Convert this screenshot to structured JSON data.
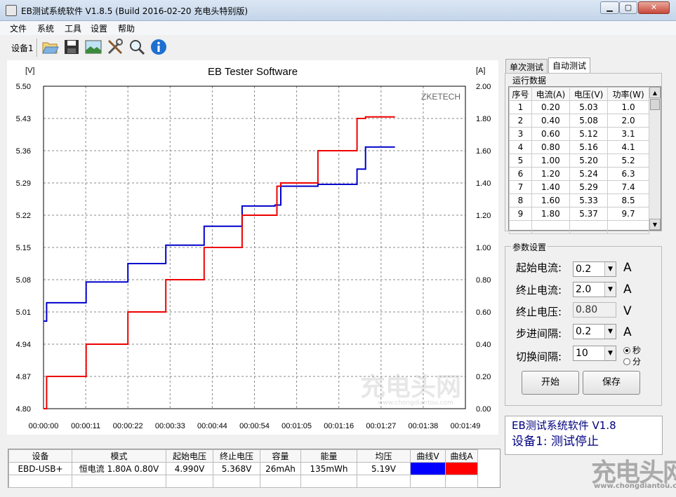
{
  "window": {
    "title": "EB测试系统软件 V1.8.5 (Build 2016-02-20 充电头特别版)"
  },
  "menu": [
    "文件",
    "系统",
    "工具",
    "设置",
    "帮助"
  ],
  "toolbar": {
    "device_label": "设备1",
    "icons": [
      "open-folder-icon",
      "save-icon",
      "image-icon",
      "tools-icon",
      "search-icon",
      "info-icon"
    ]
  },
  "chart_data": {
    "type": "line",
    "title": "EB Tester Software",
    "watermark_text": "ZKETECH",
    "y_left_unit": "[V]",
    "y_right_unit": "[A]",
    "y_left_range": [
      4.8,
      5.5
    ],
    "y_right_range": [
      0.0,
      2.0
    ],
    "x_range_seconds": [
      0,
      109
    ],
    "y_left_ticks": [
      "5.50",
      "5.43",
      "5.36",
      "5.29",
      "5.22",
      "5.15",
      "5.08",
      "5.01",
      "4.94",
      "4.87",
      "4.80"
    ],
    "y_right_ticks": [
      "2.00",
      "1.80",
      "1.60",
      "1.40",
      "1.20",
      "1.00",
      "0.80",
      "0.60",
      "0.40",
      "0.20",
      "0.00"
    ],
    "x_ticks": [
      "00:00:00",
      "00:00:11",
      "00:00:22",
      "00:00:33",
      "00:00:44",
      "00:00:54",
      "00:01:05",
      "00:01:16",
      "00:01:27",
      "00:01:38",
      "00:01:49"
    ],
    "series": [
      {
        "color": "#0000cc",
        "axis": "left",
        "x": [
          0,
          0.8,
          0.8,
          11,
          11,
          21.8,
          21.8,
          31.6,
          31.6,
          41.5,
          41.5,
          51.3,
          51.3,
          59.8,
          59.8,
          61.3,
          61.3,
          70.9,
          70.9,
          81,
          81,
          83.2,
          83.2,
          90.8
        ],
        "y": [
          4.99,
          4.99,
          5.03,
          5.03,
          5.075,
          5.075,
          5.115,
          5.115,
          5.155,
          5.155,
          5.196,
          5.196,
          5.24,
          5.24,
          5.242,
          5.242,
          5.283,
          5.283,
          5.287,
          5.287,
          5.32,
          5.32,
          5.368,
          5.368
        ]
      },
      {
        "color": "#ee0000",
        "axis": "right",
        "x": [
          0,
          0.8,
          0.8,
          11,
          11,
          21.8,
          21.8,
          31.6,
          31.6,
          41.5,
          41.5,
          51.3,
          51.3,
          60.3,
          60.3,
          61.3,
          61.3,
          70.9,
          70.9,
          81,
          81,
          83.2,
          83.2,
          90.8
        ],
        "y": [
          0,
          0,
          0.2,
          0.2,
          0.4,
          0.4,
          0.6,
          0.6,
          0.8,
          0.8,
          1.0,
          1.0,
          1.2,
          1.2,
          1.38,
          1.38,
          1.4,
          1.4,
          1.6,
          1.6,
          1.8,
          1.8,
          1.81,
          1.81
        ]
      }
    ]
  },
  "tabs": [
    "单次测试",
    "自动测试"
  ],
  "run_data": {
    "title": "运行数据",
    "columns": [
      "序号",
      "电流(A)",
      "电压(V)",
      "功率(W)"
    ],
    "rows": [
      [
        "1",
        "0.20",
        "5.03",
        "1.0"
      ],
      [
        "2",
        "0.40",
        "5.08",
        "2.0"
      ],
      [
        "3",
        "0.60",
        "5.12",
        "3.1"
      ],
      [
        "4",
        "0.80",
        "5.16",
        "4.1"
      ],
      [
        "5",
        "1.00",
        "5.20",
        "5.2"
      ],
      [
        "6",
        "1.20",
        "5.24",
        "6.3"
      ],
      [
        "7",
        "1.40",
        "5.29",
        "7.4"
      ],
      [
        "8",
        "1.60",
        "5.33",
        "8.5"
      ],
      [
        "9",
        "1.80",
        "5.37",
        "9.7"
      ]
    ]
  },
  "params": {
    "title": "参数设置",
    "start_current_label": "起始电流:",
    "start_current_value": "0.2",
    "start_current_unit": "A",
    "end_current_label": "终止电流:",
    "end_current_value": "2.0",
    "end_current_unit": "A",
    "end_voltage_label": "终止电压:",
    "end_voltage_value": "0.80",
    "end_voltage_unit": "V",
    "step_label": "步进间隔:",
    "step_value": "0.2",
    "step_unit": "A",
    "switch_label": "切换间隔:",
    "switch_value": "10",
    "radio_sec": "秒",
    "radio_min": "分",
    "start_button": "开始",
    "save_button": "保存"
  },
  "status": {
    "line1": "EB测试系统软件 V1.8",
    "line2": "设备1: 测试停止"
  },
  "summary": {
    "headers": [
      "设备",
      "模式",
      "起始电压",
      "终止电压",
      "容量",
      "能量",
      "均压",
      "曲线V",
      "曲线A"
    ],
    "row": [
      "EBD-USB+",
      "恒电流  1.80A  0.80V",
      "4.990V",
      "5.368V",
      "26mAh",
      "135mWh",
      "5.19V"
    ],
    "curve_v_color": "#0000ff",
    "curve_a_color": "#ff0000"
  },
  "watermark": {
    "logo": "充电头网",
    "url": "www.chongdiantou.com"
  }
}
